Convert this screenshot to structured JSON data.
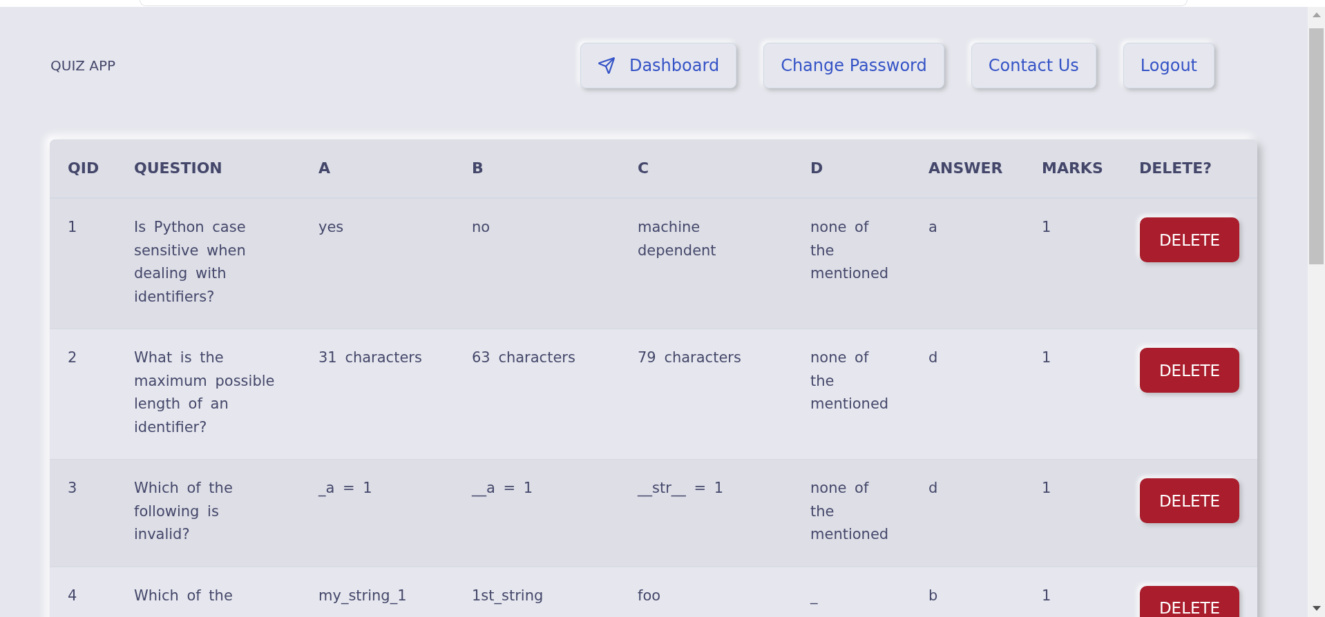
{
  "app_title": "QUIZ APP",
  "nav": [
    {
      "label": "Dashboard",
      "kind": "icon"
    },
    {
      "label": "Change Password",
      "kind": "text"
    },
    {
      "label": "Contact Us",
      "kind": "text"
    },
    {
      "label": "Logout",
      "kind": "text"
    }
  ],
  "table": {
    "columns": [
      "QID",
      "QUESTION",
      "A",
      "B",
      "C",
      "D",
      "ANSWER",
      "MARKS",
      "DELETE?"
    ],
    "rows": [
      {
        "cells": [
          "1",
          "Is Python case sensitive when dealing with identifiers?",
          "yes",
          "no",
          "machine dependent",
          "none of the mentioned",
          "a",
          "1"
        ],
        "action": "DELETE"
      },
      {
        "cells": [
          "2",
          "What is the maximum possible length of an identifier?",
          "31 characters",
          "63 characters",
          "79 characters",
          "none of the mentioned",
          "d",
          "1"
        ],
        "action": "DELETE"
      },
      {
        "cells": [
          "3",
          "Which of the following is invalid?",
          "_a = 1",
          "__a = 1",
          "__str__ = 1",
          "none of the mentioned",
          "d",
          "1"
        ],
        "action": "DELETE"
      },
      {
        "cells": [
          "4",
          "Which of the",
          "my_string_1",
          "1st_string",
          "foo",
          "_",
          "b",
          "1"
        ],
        "action": "DELETE"
      }
    ]
  }
}
